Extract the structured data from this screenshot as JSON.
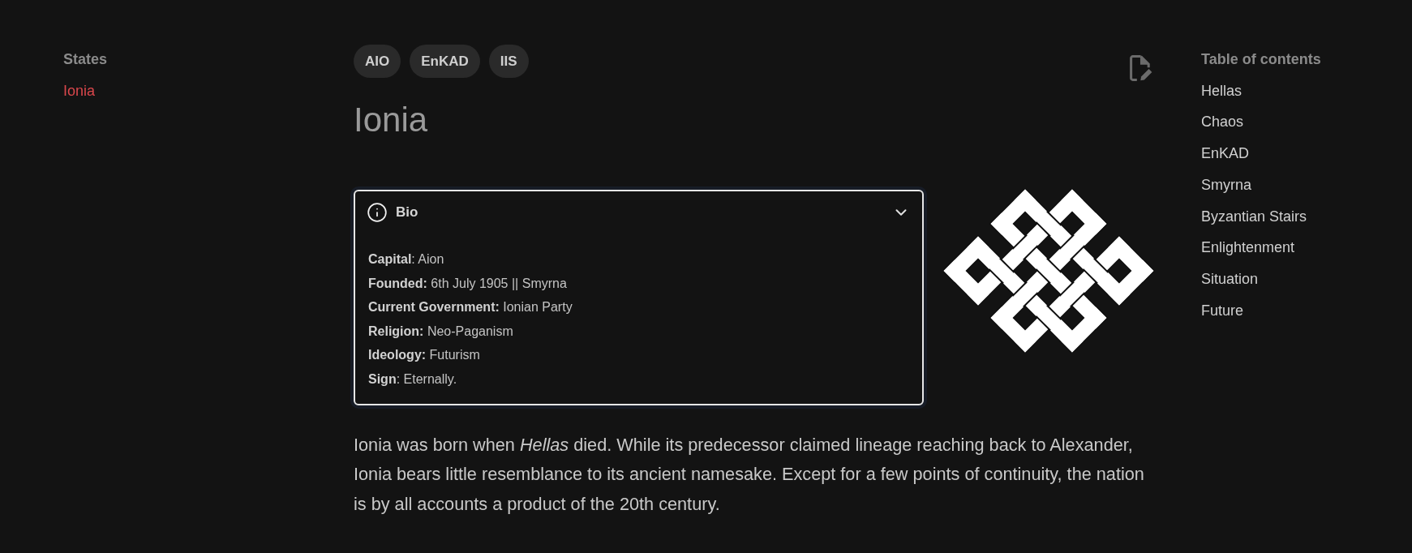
{
  "sidebar": {
    "title": "States",
    "items": [
      {
        "label": "Ionia",
        "selected": true
      }
    ]
  },
  "tags": [
    "AIO",
    "EnKAD",
    "IIS"
  ],
  "title": "Ionia",
  "bio": {
    "title": "Bio",
    "expanded": true,
    "fields": [
      "**Capital**: Aion",
      "**Founded:** 6th July 1905 || Smyrna",
      "**Current Government:** Ionian Party",
      "**Religion:** Neo-Paganism",
      "**Ideology:** Futurism",
      "**Sign**: Eternally."
    ]
  },
  "article": {
    "paragraphs": [
      "Ionia was born when *Hellas* died. While its predecessor claimed lineage reaching back to Alexander, Ionia bears little resemblance to its ancient namesake. Except for a few points of continuity, the nation is by all accounts a product of the 20th century."
    ]
  },
  "toc": {
    "title": "Table of contents",
    "items": [
      "Hellas",
      "Chaos",
      "EnKAD",
      "Smyrna",
      "Byzantian Stairs",
      "Enlightenment",
      "Situation",
      "Future"
    ]
  }
}
